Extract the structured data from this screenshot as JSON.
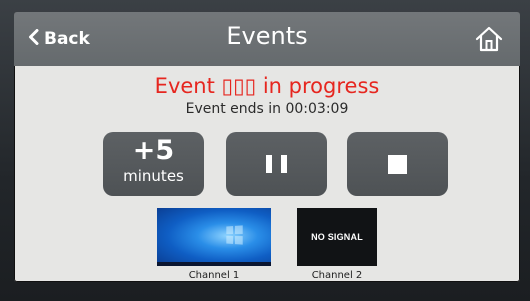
{
  "header": {
    "back_label": "Back",
    "title": "Events",
    "home_icon": "home-icon"
  },
  "status": {
    "title": "Event ▯▯▯ in progress",
    "ends_line": "Event ends in 00:03:09"
  },
  "controls": {
    "add_time": {
      "amount": "+5",
      "unit": "minutes"
    },
    "pause_icon": "pause-icon",
    "stop_icon": "stop-icon"
  },
  "channels": [
    {
      "label": "Channel 1",
      "preview": "windows-desktop"
    },
    {
      "label": "Channel 2",
      "preview_text": "NO SIGNAL"
    }
  ],
  "colors": {
    "topbar": "#696d70",
    "status_red": "#e6261f",
    "button_gray": "#56595c",
    "screen_bg": "#e6e6e4"
  }
}
